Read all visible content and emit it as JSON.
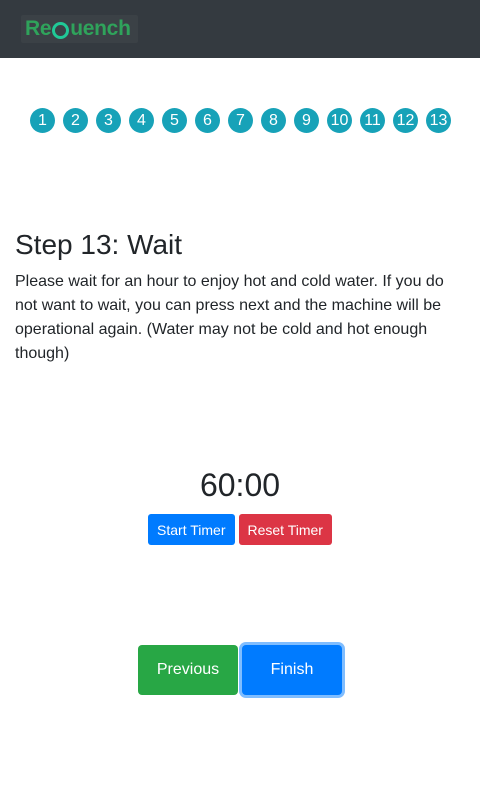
{
  "brand": {
    "logo_text_a": "Re",
    "logo_text_b": "uench"
  },
  "steps": [
    "1",
    "2",
    "3",
    "4",
    "5",
    "6",
    "7",
    "8",
    "9",
    "10",
    "11",
    "12",
    "13"
  ],
  "step": {
    "title": "Step 13: Wait",
    "description": "Please wait for an hour to enjoy hot and cold water. If you do not want to wait, you can press next and the machine will be operational again. (Water may not be cold and hot enough though)"
  },
  "timer": {
    "display": "60:00",
    "start_label": "Start Timer",
    "reset_label": "Reset Timer"
  },
  "navigation": {
    "previous_label": "Previous",
    "finish_label": "Finish"
  },
  "colors": {
    "navbar": "#343a40",
    "step_badge": "#17a2b8",
    "primary": "#007bff",
    "danger": "#dc3545",
    "success": "#28a745"
  }
}
